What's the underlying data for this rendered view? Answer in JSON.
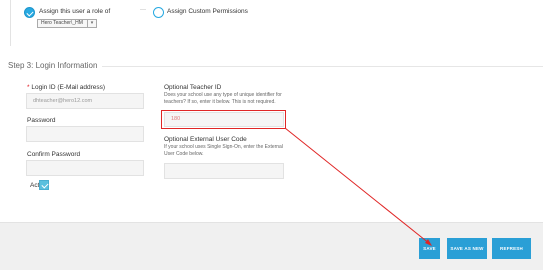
{
  "role_section": {
    "assign_role_label": "Assign this user a role of",
    "or_dash": "—",
    "role_select_value": "Hero Teacher\\_HM",
    "custom_permissions_label": "Assign Custom Permissions"
  },
  "step3": {
    "title": "Step 3: Login Information",
    "login_id_label": "Login ID (E-Mail address)",
    "login_id_required_mark": "*",
    "login_id_placeholder": "dhteacher@hero12.com",
    "password_label": "Password",
    "confirm_password_label": "Confirm Password",
    "active_label": "Active",
    "teacher_id_label": "Optional Teacher ID",
    "teacher_id_help": "Does your school use any type of unique identifier for teachers? If so, enter it below. This is not required.",
    "teacher_id_value": "180",
    "external_code_label": "Optional External User Code",
    "external_code_help": "If your school uses Single Sign-On, enter the External User Code below."
  },
  "footer": {
    "save_label": "SAVE",
    "save_as_new_label": "SAVE AS NEW",
    "refresh_label": "REFRESH"
  },
  "colors": {
    "accent": "#2a9fd6",
    "highlight": "#e02626"
  }
}
